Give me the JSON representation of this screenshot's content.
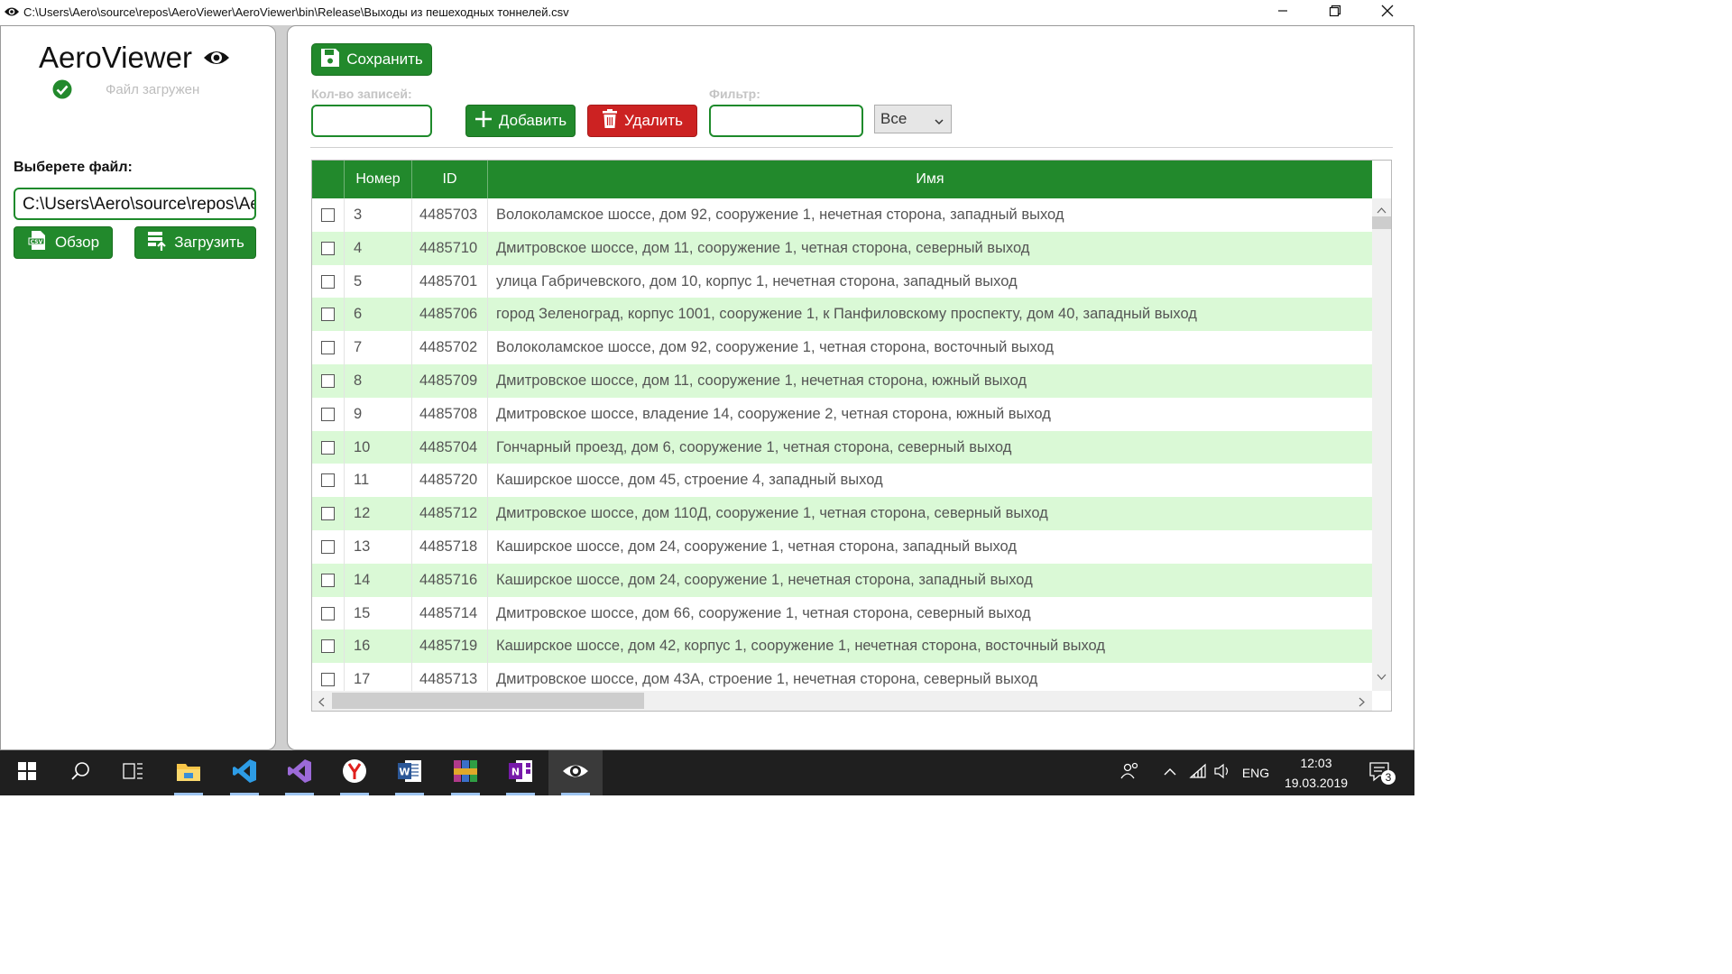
{
  "window": {
    "title": "C:\\Users\\Aero\\source\\repos\\AeroViewer\\AeroViewer\\bin\\Release\\Выходы из пешеходных тоннелей.csv",
    "icons": [
      "app-eye-icon",
      "minimize-icon",
      "restore-icon",
      "close-icon"
    ]
  },
  "sidebar": {
    "app_name": "AeroViewer",
    "status_text": "Файл загружен",
    "file_label": "Выберете файл:",
    "file_path": "C:\\Users\\Aero\\source\\repos\\AeroViewer\\AeroViewer\\bin\\Release\\Выходы из пешеходных тоннелей.csv",
    "browse_label": "Обзор",
    "load_label": "Загрузить"
  },
  "toolbar": {
    "save_label": "Сохранить",
    "count_label": "Кол-во записей:",
    "count_value": "",
    "add_label": "Добавить",
    "delete_label": "Удалить",
    "filter_label": "Фильтр:",
    "filter_value": "",
    "filter_select": "Все"
  },
  "colors": {
    "accent_green": "#22892c",
    "danger_red": "#cc2222",
    "row_alt": "#daf9d6"
  },
  "table": {
    "columns": [
      "",
      "Номер",
      "ID",
      "Имя"
    ],
    "rows": [
      {
        "num": "3",
        "id": "4485703",
        "name": "Волоколамское шоссе, дом 92, сооружение 1, нечетная сторона, западный выход",
        "checked": false
      },
      {
        "num": "4",
        "id": "4485710",
        "name": "Дмитровское шоссе, дом 11, сооружение 1, четная сторона, северный выход",
        "checked": false
      },
      {
        "num": "5",
        "id": "4485701",
        "name": "улица Габричевского, дом 10, корпус 1, нечетная сторона, западный выход",
        "checked": false
      },
      {
        "num": "6",
        "id": "4485706",
        "name": "город Зеленоград, корпус 1001, сооружение 1, к Панфиловскому проспекту, дом 40, западный выход",
        "checked": false
      },
      {
        "num": "7",
        "id": "4485702",
        "name": "Волоколамское шоссе, дом 92, сооружение 1, четная сторона, восточный выход",
        "checked": false
      },
      {
        "num": "8",
        "id": "4485709",
        "name": "Дмитровское шоссе, дом 11, сооружение 1, нечетная сторона, южный выход",
        "checked": false
      },
      {
        "num": "9",
        "id": "4485708",
        "name": "Дмитровское шоссе, владение 14, сооружение 2, четная сторона, южный выход",
        "checked": false
      },
      {
        "num": "10",
        "id": "4485704",
        "name": "Гончарный проезд, дом 6, сооружение 1, четная сторона, северный выход",
        "checked": false
      },
      {
        "num": "11",
        "id": "4485720",
        "name": "Каширское шоссе, дом 45, строение 4, западный выход",
        "checked": false
      },
      {
        "num": "12",
        "id": "4485712",
        "name": "Дмитровское шоссе, дом 110Д, сооружение 1, четная сторона, северный выход",
        "checked": false
      },
      {
        "num": "13",
        "id": "4485718",
        "name": "Каширское шоссе, дом 24, сооружение 1, четная сторона, западный выход",
        "checked": false
      },
      {
        "num": "14",
        "id": "4485716",
        "name": "Каширское шоссе, дом 24, сооружение 1, нечетная сторона, западный выход",
        "checked": false
      },
      {
        "num": "15",
        "id": "4485714",
        "name": "Дмитровское шоссе, дом 66, сооружение 1, четная сторона, северный выход",
        "checked": false
      },
      {
        "num": "16",
        "id": "4485719",
        "name": "Каширское шоссе, дом 42, корпус 1, сооружение 1, нечетная сторона, восточный выход",
        "checked": false
      },
      {
        "num": "17",
        "id": "4485713",
        "name": "Дмитровское шоссе, дом 43А, строение 1, нечетная сторона, северный выход",
        "checked": false
      }
    ]
  },
  "taskbar": {
    "apps": [
      "windows-start-icon",
      "search-icon",
      "task-view-icon",
      "file-explorer-icon",
      "vscode-icon",
      "visual-studio-icon",
      "yandex-browser-icon",
      "word-icon",
      "winrar-icon",
      "onenote-icon",
      "aeroviewer-icon"
    ],
    "language": "ENG",
    "time": "12:03",
    "date": "19.03.2019",
    "notification_count": "3"
  }
}
